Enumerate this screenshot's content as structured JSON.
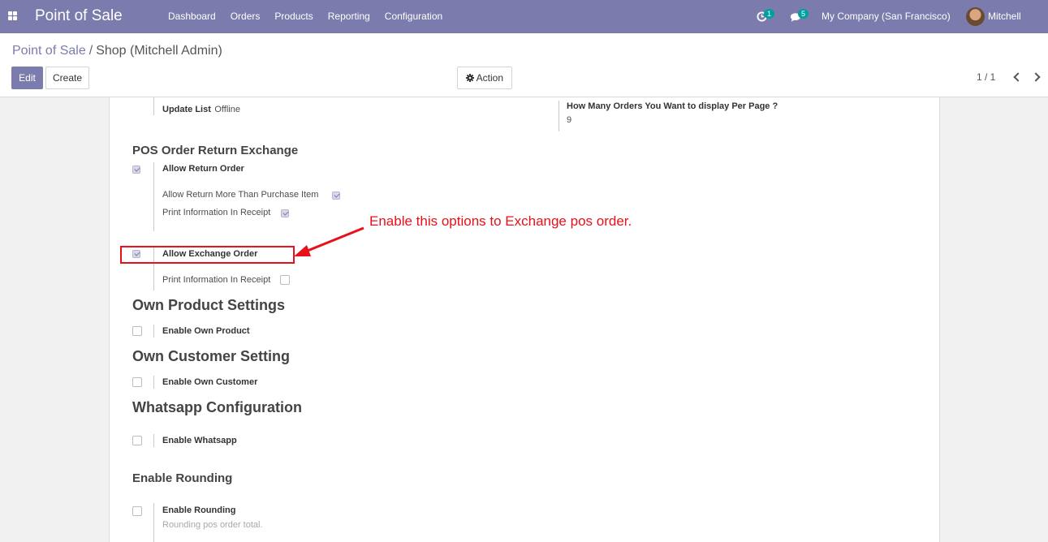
{
  "navbar": {
    "apps_icon": "apps-grid-icon",
    "brand": "Point of Sale",
    "menu": [
      "Dashboard",
      "Orders",
      "Products",
      "Reporting",
      "Configuration"
    ],
    "activity_badge": "1",
    "messages_badge": "5",
    "company": "My Company (San Francisco)",
    "user": "Mitchell Admin"
  },
  "breadcrumb": {
    "parent": "Point of Sale",
    "separator": "/",
    "current": "Shop (Mitchell Admin)"
  },
  "buttons": {
    "edit": "Edit",
    "create": "Create",
    "action": "Action"
  },
  "pager": {
    "value": "1 / 1"
  },
  "form": {
    "update_list": {
      "label": "Update List",
      "value": "Offline"
    },
    "orders_per_page": {
      "label": "How Many Orders You Want to display Per Page ?",
      "value": "9"
    },
    "return_exchange": {
      "title": "POS Order Return Exchange",
      "allow_return": {
        "label": "Allow Return Order",
        "checked": true
      },
      "return_more": {
        "label": "Allow Return More Than Purchase Item",
        "checked": true
      },
      "return_print": {
        "label": "Print Information In Receipt",
        "checked": true
      },
      "allow_exchange": {
        "label": "Allow Exchange Order",
        "checked": true
      },
      "exchange_print": {
        "label": "Print Information In Receipt",
        "checked": false
      }
    },
    "own_product": {
      "title": "Own Product Settings",
      "label": "Enable Own Product",
      "checked": false
    },
    "own_customer": {
      "title": "Own Customer Setting",
      "label": "Enable Own Customer",
      "checked": false
    },
    "whatsapp": {
      "title": "Whatsapp Configuration",
      "label": "Enable Whatsapp",
      "checked": false
    },
    "rounding": {
      "title": "Enable Rounding",
      "label": "Enable Rounding",
      "help": "Rounding pos order total.",
      "checked": false
    }
  },
  "annotation": {
    "text": "Enable this options to Exchange pos order.",
    "color": "#e8101a"
  },
  "colors": {
    "primary": "#7c7bad",
    "badge": "#00a09d"
  }
}
